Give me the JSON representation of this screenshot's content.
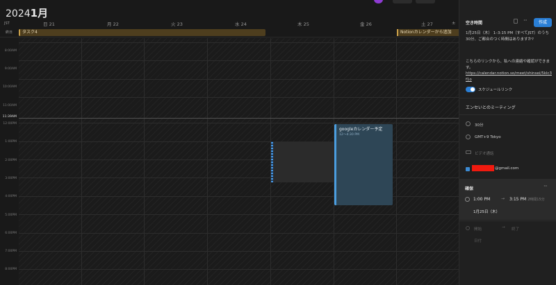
{
  "header": {
    "year": "2024",
    "month": "1月"
  },
  "timezone": "JST",
  "days": [
    {
      "label": "日 21"
    },
    {
      "label": "月 22"
    },
    {
      "label": "火 23"
    },
    {
      "label": "水 24"
    },
    {
      "label": "木 25"
    },
    {
      "label": "金 26"
    },
    {
      "label": "土 27"
    }
  ],
  "allday": {
    "label": "終日",
    "task": "タスク4",
    "notion": "Notionカレンダーから追加"
  },
  "hours": [
    "8:00AM",
    "9:00AM",
    "10:00AM",
    "11:00AM",
    "12:00PM",
    "1:00PM",
    "2:00PM",
    "3:00PM",
    "4:00PM",
    "5:00PM",
    "6:00PM",
    "7:00PM",
    "8:00PM"
  ],
  "current_time": "11:39AM",
  "event": {
    "title": "googleカレンダー予定",
    "time": "12～4:30 PM"
  },
  "panel": {
    "title": "空き時間",
    "create": "作成",
    "description": "1月25日（木） 1–3:15 PM（すべてJST）のうち30分、ご都合のつく時間はありますか?",
    "link_intro": "こちらのリンクから、私への連絡や確認ができます。",
    "link": "https://calendar.notion.so/meet/shinsei/5klc3f1o",
    "toggle_label": "スケジュールリンク",
    "meeting_title": "エンセいとのミーティング",
    "duration": "30分",
    "timezone": "GMT+9 Tokyo",
    "video": "ビデオ通話",
    "guest_suffix": "@gmail.com",
    "confirm": {
      "title": "確保",
      "start": "1:00 PM",
      "end": "3:15 PM",
      "duration": "2時間15分",
      "date": "1月25日（木）"
    },
    "lower": {
      "start": "開始",
      "end": "終了",
      "date": "日付"
    }
  }
}
